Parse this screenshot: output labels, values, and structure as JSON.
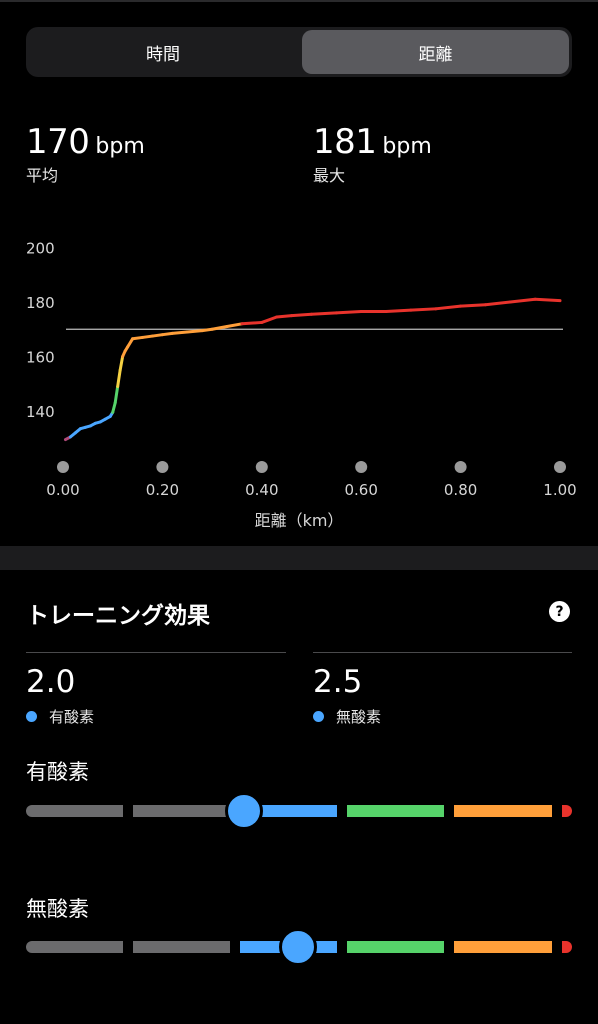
{
  "tabs": [
    {
      "label": "時間",
      "selected": false
    },
    {
      "label": "距離",
      "selected": true
    }
  ],
  "stats": {
    "avg": {
      "value": "170",
      "unit": "bpm",
      "label": "平均"
    },
    "max": {
      "value": "181",
      "unit": "bpm",
      "label": "最大"
    }
  },
  "chart_data": {
    "type": "line",
    "xlabel": "距離（km）",
    "ylabel": "",
    "xlim": [
      0,
      1.0
    ],
    "ylim": [
      125,
      205
    ],
    "x_ticks": [
      "0.00",
      "0.20",
      "0.40",
      "0.60",
      "0.80",
      "1.00"
    ],
    "y_ticks": [
      "140",
      "160",
      "180",
      "200"
    ],
    "reference_line": 170,
    "series": [
      {
        "x": [
          0.005,
          0.015,
          0.025,
          0.035,
          0.045,
          0.055,
          0.065,
          0.075,
          0.085,
          0.095,
          0.1,
          0.105,
          0.11,
          0.115,
          0.12,
          0.125,
          0.13,
          0.14,
          0.16,
          0.18,
          0.2,
          0.22,
          0.25,
          0.28,
          0.3,
          0.33,
          0.36,
          0.4,
          0.43,
          0.46,
          0.5,
          0.55,
          0.6,
          0.65,
          0.7,
          0.75,
          0.8,
          0.85,
          0.9,
          0.95,
          1.0
        ],
        "values": [
          129.5,
          130.5,
          132,
          133.5,
          134,
          134.5,
          135.5,
          136,
          137,
          138,
          139.5,
          143,
          149,
          155,
          160,
          162,
          163.5,
          166.5,
          167,
          167.5,
          168,
          168.5,
          169,
          169.5,
          170,
          171,
          172,
          172.5,
          174.5,
          175,
          175.5,
          176,
          176.5,
          176.5,
          177,
          177.5,
          178.5,
          179,
          180,
          181,
          180.5
        ]
      }
    ],
    "heart_rate_gradient": [
      "#b04a7a",
      "#4aa6ff",
      "#56d36a",
      "#f5d142",
      "#ff9f3a",
      "#e8332c"
    ]
  },
  "training_effect": {
    "title": "トレーニング効果",
    "aerobic": {
      "value": "2.0",
      "label": "有酸素"
    },
    "anaerobic": {
      "value": "2.5",
      "label": "無酸素"
    }
  },
  "bars": {
    "aerobic": {
      "title": "有酸素",
      "level": 2.0,
      "max": 5.0
    },
    "anaerobic": {
      "title": "無酸素",
      "level": 2.5,
      "max": 5.0
    }
  },
  "colors": {
    "gray": "#6b6b6d",
    "blue": "#4aa6ff",
    "green": "#56d36a",
    "orange": "#ff9f3a",
    "red": "#e8332c"
  }
}
